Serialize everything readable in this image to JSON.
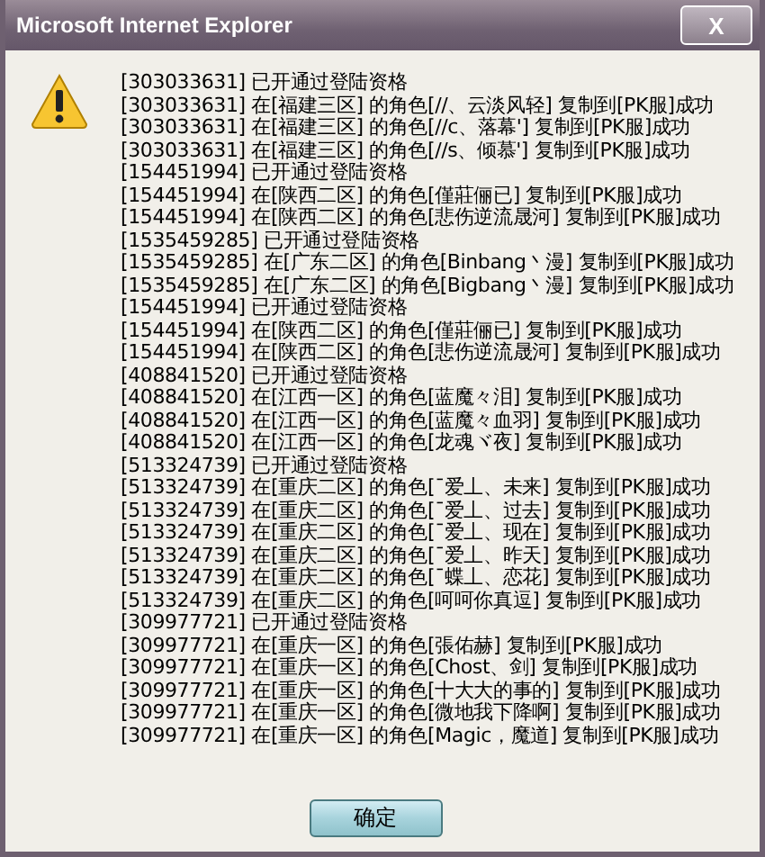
{
  "window": {
    "title": "Microsoft Internet Explorer",
    "close": "X"
  },
  "message": {
    "lines": [
      "[303033631] 已开通过登陆资格",
      "[303033631] 在[福建三区] 的角色[//、云淡风轻] 复制到[PK服]成功",
      "[303033631] 在[福建三区] 的角色[//c、落幕'] 复制到[PK服]成功",
      "[303033631] 在[福建三区] 的角色[//s、倾慕'] 复制到[PK服]成功",
      "[154451994] 已开通过登陆资格",
      "[154451994] 在[陕西二区] 的角色[僅莊俪已] 复制到[PK服]成功",
      "[154451994] 在[陕西二区] 的角色[悲伤逆流晟河] 复制到[PK服]成功",
      "[1535459285] 已开通过登陆资格",
      "[1535459285] 在[广东二区] 的角色[Binbang丶漫] 复制到[PK服]成功",
      "[1535459285] 在[广东二区] 的角色[Bigbang丶漫] 复制到[PK服]成功",
      "[154451994] 已开通过登陆资格",
      "[154451994] 在[陕西二区] 的角色[僅莊俪已] 复制到[PK服]成功",
      "[154451994] 在[陕西二区] 的角色[悲伤逆流晟河] 复制到[PK服]成功",
      "[408841520] 已开通过登陆资格",
      "[408841520] 在[江西一区] 的角色[蓝魔々泪] 复制到[PK服]成功",
      "[408841520] 在[江西一区] 的角色[蓝魔々血羽] 复制到[PK服]成功",
      "[408841520] 在[江西一区] 的角色[龙魂ヾ夜] 复制到[PK服]成功",
      "[513324739] 已开通过登陆资格",
      "[513324739] 在[重庆二区] 的角色[ˉ爱丄、未来] 复制到[PK服]成功",
      "[513324739] 在[重庆二区] 的角色[ˉ爱丄、过去] 复制到[PK服]成功",
      "[513324739] 在[重庆二区] 的角色[ˉ爱丄、现在] 复制到[PK服]成功",
      "[513324739] 在[重庆二区] 的角色[ˉ爱丄、昨天] 复制到[PK服]成功",
      "[513324739] 在[重庆二区] 的角色[ˉ蝶丄、恋花] 复制到[PK服]成功",
      "[513324739] 在[重庆二区] 的角色[呵呵你真逗] 复制到[PK服]成功",
      "[309977721] 已开通过登陆资格",
      "[309977721] 在[重庆一区] 的角色[張佑赫] 复制到[PK服]成功",
      "[309977721] 在[重庆一区] 的角色[Chost、剑] 复制到[PK服]成功",
      "[309977721] 在[重庆一区] 的角色[十大大的事的] 复制到[PK服]成功",
      "[309977721] 在[重庆一区] 的角色[微地我下降啊] 复制到[PK服]成功",
      "[309977721] 在[重庆一区] 的角色[Magic，魔道] 复制到[PK服]成功"
    ]
  },
  "buttons": [
    "确定"
  ]
}
